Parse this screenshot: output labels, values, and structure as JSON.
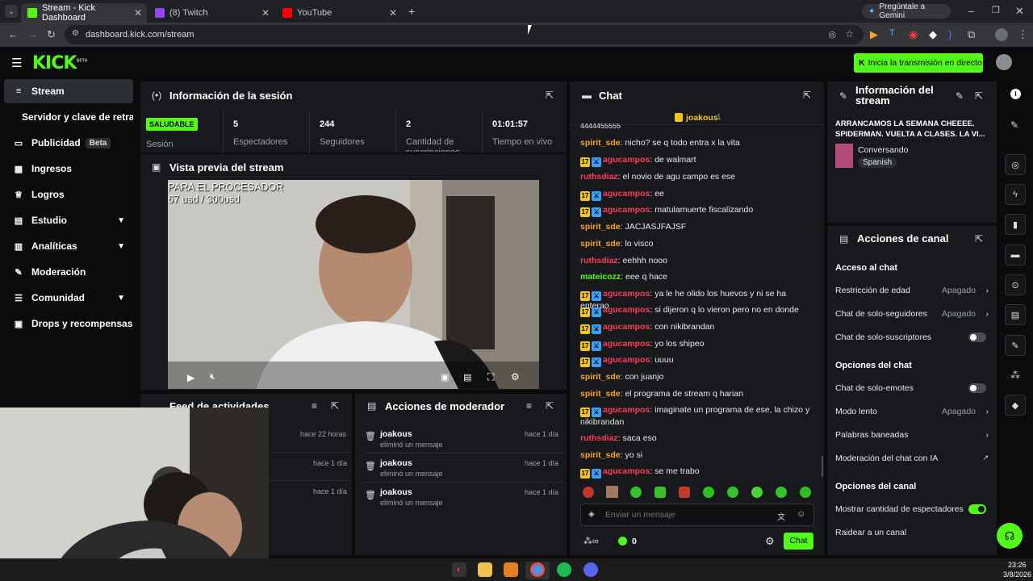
{
  "browser": {
    "tabs": [
      {
        "label": "Stream - Kick Dashboard",
        "active": true
      },
      {
        "label": "(8) Twitch",
        "active": false
      },
      {
        "label": "YouTube",
        "active": false
      }
    ],
    "gemini": "Pregúntale a Gemini",
    "url": "dashboard.kick.com/stream"
  },
  "header": {
    "logo": "KICK",
    "logo_sup": "BETA",
    "go_live": "Inicia la transmisión en directo"
  },
  "sidebar": {
    "items": [
      {
        "label": "Stream",
        "icon": "≡"
      },
      {
        "label": "Servidor y clave de retransmisión",
        "icon": ""
      },
      {
        "label": "Publicidad",
        "icon": "▭",
        "badge": "Beta"
      },
      {
        "label": "Ingresos",
        "icon": "▦"
      },
      {
        "label": "Logros",
        "icon": "♕"
      },
      {
        "label": "Estudio",
        "icon": "▤"
      },
      {
        "label": "Analíticas",
        "icon": "▥"
      },
      {
        "label": "Moderación",
        "icon": "✎"
      },
      {
        "label": "Comunidad",
        "icon": "☰"
      },
      {
        "label": "Drops y recompensas",
        "icon": "▣"
      }
    ]
  },
  "session": {
    "title": "Información de la sesión",
    "status_badge": "SALUDABLE",
    "status_label": "Sesión",
    "stats": [
      {
        "value": "5",
        "label": "Espectadores"
      },
      {
        "value": "244",
        "label": "Seguidores"
      },
      {
        "value": "2",
        "label": "Cantidad de suscripciones"
      },
      {
        "value": "01:01:57",
        "label": "Tiempo en vivo"
      }
    ]
  },
  "preview": {
    "title": "Vista previa del stream",
    "overlay_line1": "PARA EL PROCESADOR",
    "overlay_line2": "67 usd / 300usd"
  },
  "feed": {
    "title": "Feed de actividades",
    "times": [
      "hace 22 horas",
      "hace 1 día",
      "hace 1 día"
    ]
  },
  "modactions": {
    "title": "Acciones de moderador",
    "rows": [
      {
        "user": "joakous",
        "action": "eliminó un mensaje",
        "time": "hace 1 día"
      },
      {
        "user": "joakous",
        "action": "eliminó un mensaje",
        "time": "hace 1 día"
      },
      {
        "user": "joakous",
        "action": "eliminó un mensaje",
        "time": "hace 1 día"
      }
    ]
  },
  "chat": {
    "title": "Chat",
    "pinned_user": "joakous",
    "pinned_count": "1",
    "cutoff": "4444455555",
    "messages": [
      {
        "user": "spirit_sde",
        "color": "orange",
        "badges": [],
        "text": "nicho? se q todo entra x la vita"
      },
      {
        "user": "agucampos",
        "color": "red",
        "badges": [
          "17",
          "mod"
        ],
        "text": "de walmart"
      },
      {
        "user": "ruthsdiaz",
        "color": "red",
        "badges": [],
        "text": "el novio de agu campo es ese"
      },
      {
        "user": "agucampos",
        "color": "red",
        "badges": [
          "17",
          "mod"
        ],
        "text": "ee"
      },
      {
        "user": "agucampos",
        "color": "red",
        "badges": [
          "17",
          "mod"
        ],
        "text": "matulamuerte fiscalizando"
      },
      {
        "user": "spirit_sde",
        "color": "orange",
        "badges": [],
        "text": "JACJASJFAJSF"
      },
      {
        "user": "spirit_sde",
        "color": "orange",
        "badges": [],
        "text": "lo visco"
      },
      {
        "user": "ruthsdiaz",
        "color": "red",
        "badges": [],
        "text": "eehhh nooo"
      },
      {
        "user": "mateicozz",
        "color": "green",
        "badges": [],
        "text": "eee q hace"
      },
      {
        "user": "agucampos",
        "color": "red",
        "badges": [
          "17",
          "mod"
        ],
        "text": "ya le he olido los huevos y ni se ha enterao"
      },
      {
        "user": "agucampos",
        "color": "red",
        "badges": [
          "17",
          "mod"
        ],
        "text": "si dijeron q lo vieron pero no en donde"
      },
      {
        "user": "agucampos",
        "color": "red",
        "badges": [
          "17",
          "mod"
        ],
        "text": "con nikibrandan"
      },
      {
        "user": "agucampos",
        "color": "red",
        "badges": [
          "17",
          "mod"
        ],
        "text": "yo los shipeo"
      },
      {
        "user": "agucampos",
        "color": "red",
        "badges": [
          "17",
          "mod"
        ],
        "text": "uuuu"
      },
      {
        "user": "spirit_sde",
        "color": "orange",
        "badges": [],
        "text": "con juanjo"
      },
      {
        "user": "spirit_sde",
        "color": "orange",
        "badges": [],
        "text": "el programa de stream q harian"
      },
      {
        "user": "agucampos",
        "color": "red",
        "badges": [
          "17",
          "mod"
        ],
        "text": "imaginate un programa de ese, la chizo y nikibrandan"
      },
      {
        "user": "ruthsdiaz",
        "color": "red",
        "badges": [],
        "text": "saca eso"
      },
      {
        "user": "spirit_sde",
        "color": "orange",
        "badges": [],
        "text": "yo si"
      },
      {
        "user": "agucampos",
        "color": "red",
        "badges": [
          "17",
          "mod"
        ],
        "text": "se me trabo"
      }
    ],
    "input_placeholder": "Enviar un mensaje",
    "points": "0",
    "send": "Chat"
  },
  "stream_info": {
    "title": "Información del stream",
    "stream_title": "ARRANCAMOS LA SEMANA CHEEEE. SPIDERMAN. VUELTA A CLASES. LA VI...",
    "category": "Conversando",
    "language": "Spanish"
  },
  "channel_actions": {
    "title": "Acciones de canal",
    "sec_chat_access": "Acceso al chat",
    "age_restriction": "Restricción de edad",
    "age_restriction_val": "Apagado",
    "followers_only": "Chat de solo-seguidores",
    "followers_only_val": "Apagado",
    "subs_only": "Chat de solo-suscriptores",
    "sec_chat_options": "Opciones del chat",
    "emotes_only": "Chat de solo-emotes",
    "slow_mode": "Modo lento",
    "slow_mode_val": "Apagado",
    "banned_words": "Palabras baneadas",
    "ai_moderation": "Moderación del chat con IA",
    "sec_channel_options": "Opciones del canal",
    "show_viewers": "Mostrar cantidad de espectadores",
    "raid": "Raidear a un canal"
  },
  "taskbar": {
    "time": "23:26",
    "date": "3/8/2026"
  }
}
